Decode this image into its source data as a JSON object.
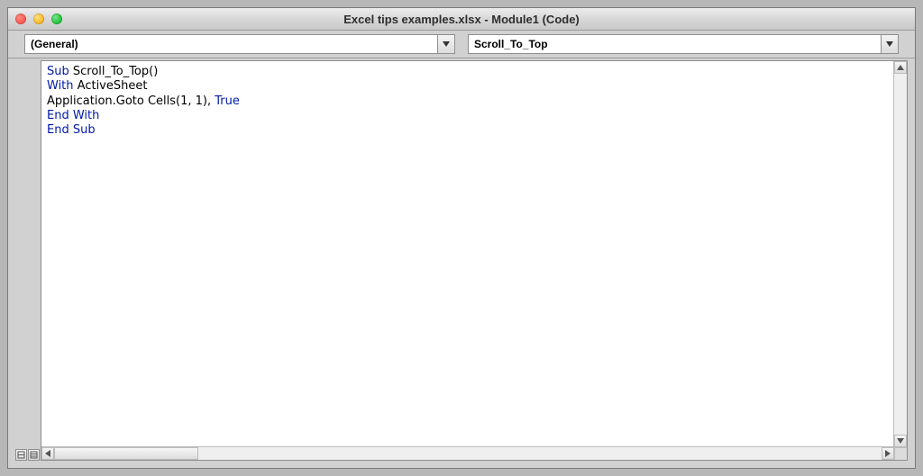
{
  "window": {
    "title": "Excel tips examples.xlsx - Module1 (Code)"
  },
  "dropdowns": {
    "scope": "(General)",
    "procedure": "Scroll_To_Top"
  },
  "code": {
    "line1_kw": "Sub",
    "line1_rest": " Scroll_To_Top()",
    "line2_kw": "With",
    "line2_rest": " ActiveSheet",
    "line3_a": "Application.Goto Cells(1, 1), ",
    "line3_kw": "True",
    "line4": "End With",
    "line5": "End Sub"
  }
}
